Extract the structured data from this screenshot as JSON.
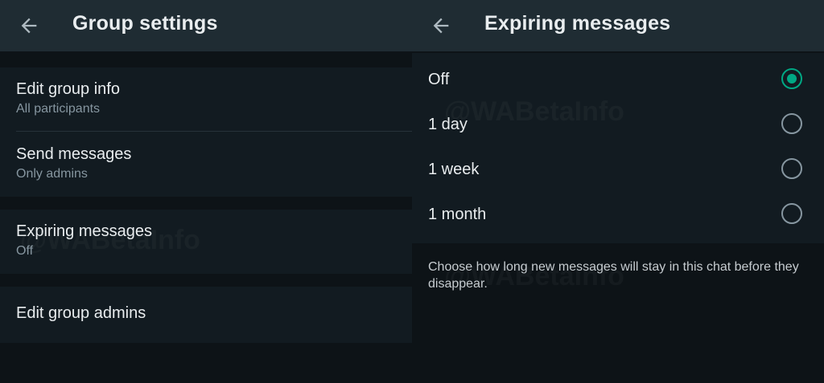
{
  "left": {
    "title": "Group settings",
    "items": [
      {
        "title": "Edit group info",
        "subtitle": "All participants"
      },
      {
        "title": "Send messages",
        "subtitle": "Only admins"
      },
      {
        "title": "Expiring messages",
        "subtitle": "Off"
      },
      {
        "title": "Edit group admins"
      }
    ]
  },
  "right": {
    "title": "Expiring messages",
    "options": [
      {
        "label": "Off",
        "selected": true
      },
      {
        "label": "1 day",
        "selected": false
      },
      {
        "label": "1 week",
        "selected": false
      },
      {
        "label": "1 month",
        "selected": false
      }
    ],
    "description": "Choose how long new messages will stay in this chat before they disappear."
  },
  "watermark": "@WABetaInfo",
  "colors": {
    "accent": "#00a884",
    "appbar": "#1f2c33",
    "background": "#0d1317",
    "surface": "#121b21"
  },
  "icons": {
    "back": "arrow-left-icon",
    "radio_on": "radio-checked-icon",
    "radio_off": "radio-unchecked-icon"
  }
}
